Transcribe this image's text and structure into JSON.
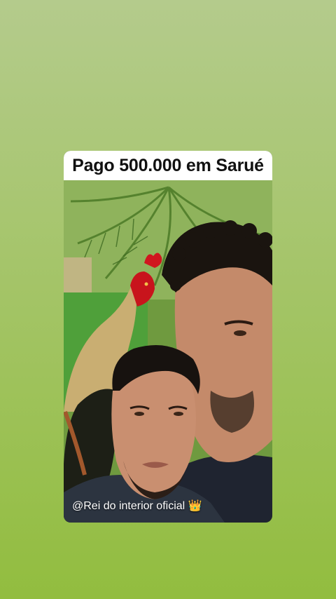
{
  "story": {
    "background_top": "#b4cb8c",
    "background_bottom": "#92bd3f"
  },
  "post": {
    "caption": "Pago 500.000 em Sarué",
    "watermark": "@Rei do interior oficial 👑"
  }
}
